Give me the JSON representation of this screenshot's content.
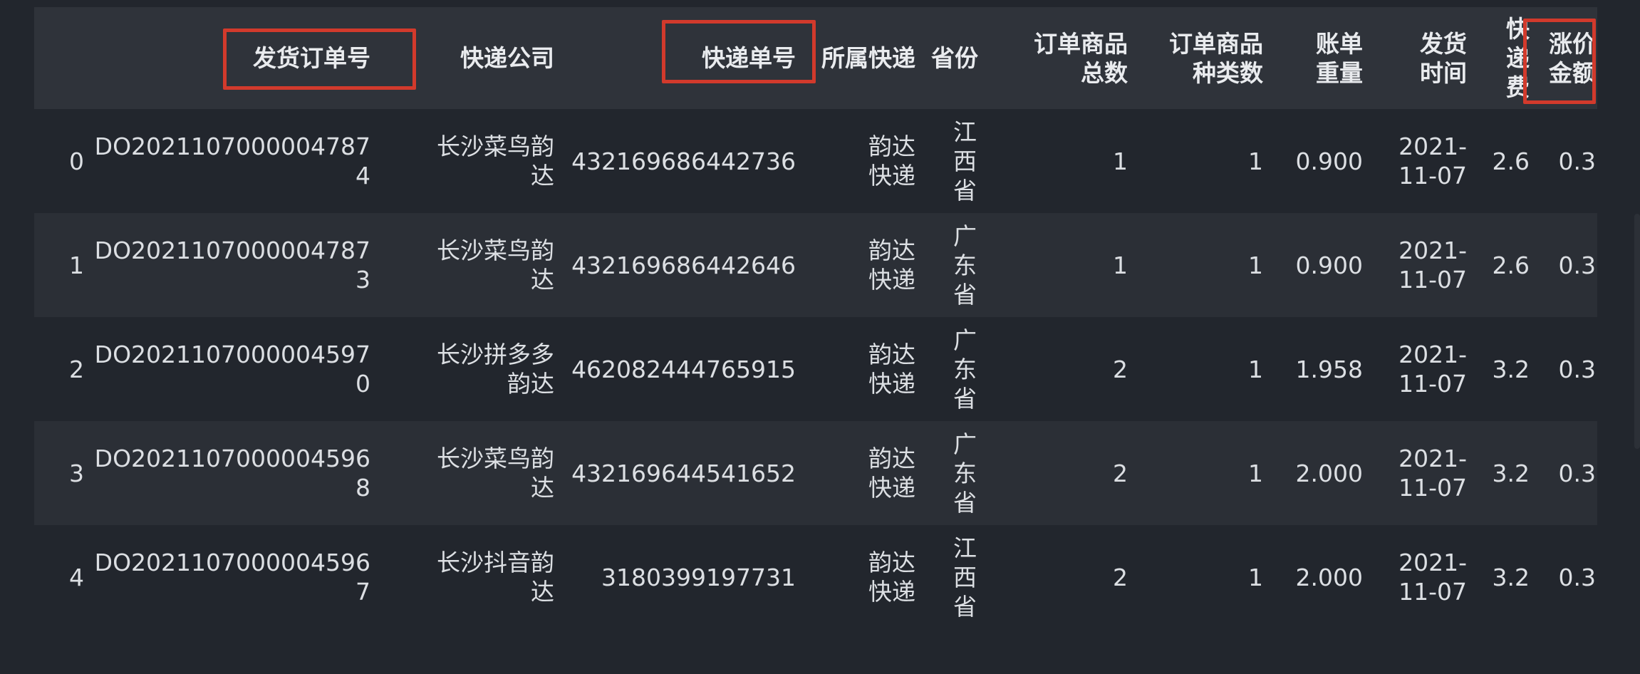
{
  "table": {
    "columns": [
      {
        "key": "index",
        "label": ""
      },
      {
        "key": "order_no",
        "label": "发货订单号"
      },
      {
        "key": "courier_company",
        "label": "快递公司"
      },
      {
        "key": "tracking_no",
        "label": "快递单号"
      },
      {
        "key": "courier_group",
        "label": "所属快递"
      },
      {
        "key": "province",
        "label": "省份"
      },
      {
        "key": "total_items",
        "label": "订单商品总数"
      },
      {
        "key": "item_kinds",
        "label": "订单商品种类数"
      },
      {
        "key": "bill_weight",
        "label": "账单重量"
      },
      {
        "key": "ship_time",
        "label": "发货时间"
      },
      {
        "key": "fee",
        "label": "快递费"
      },
      {
        "key": "price_increase",
        "label": "涨价金额"
      }
    ],
    "rows": [
      [
        "0",
        "DO20211070000047874",
        "长沙菜鸟韵达",
        "432169686442736",
        "韵达快递",
        "江西省",
        "1",
        "1",
        "0.900",
        "2021-11-07",
        "2.6",
        "0.3"
      ],
      [
        "1",
        "DO20211070000047873",
        "长沙菜鸟韵达",
        "432169686442646",
        "韵达快递",
        "广东省",
        "1",
        "1",
        "0.900",
        "2021-11-07",
        "2.6",
        "0.3"
      ],
      [
        "2",
        "DO20211070000045970",
        "长沙拼多多韵达",
        "462082444765915",
        "韵达快递",
        "广东省",
        "2",
        "1",
        "1.958",
        "2021-11-07",
        "3.2",
        "0.3"
      ],
      [
        "3",
        "DO20211070000045968",
        "长沙菜鸟韵达",
        "432169644541652",
        "韵达快递",
        "广东省",
        "2",
        "1",
        "2.000",
        "2021-11-07",
        "3.2",
        "0.3"
      ],
      [
        "4",
        "DO20211070000045967",
        "长沙抖音韵达",
        "3180399197731",
        "韵达快递",
        "江西省",
        "2",
        "1",
        "2.000",
        "2021-11-07",
        "3.2",
        "0.3"
      ]
    ]
  },
  "highlight_color": "#d23a2c"
}
